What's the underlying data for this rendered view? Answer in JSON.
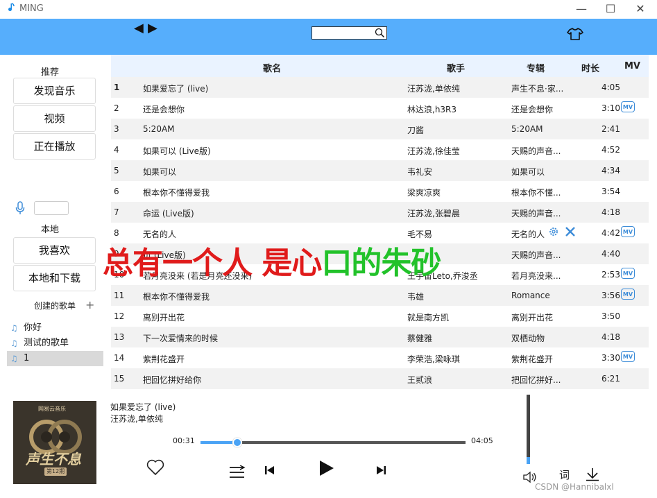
{
  "window": {
    "title": "MING",
    "min_symbol": "—",
    "max_symbol": "☐",
    "close_symbol": "✕"
  },
  "header": {
    "back_symbol": "◀",
    "forward_symbol": "▶",
    "search_placeholder": "",
    "accent_color": "#56aefc"
  },
  "sidebar": {
    "recommend_heading": "推荐",
    "recommend_items": [
      "发现音乐",
      "视频",
      "正在播放"
    ],
    "local_heading": "本地",
    "local_items": [
      "我喜欢",
      "本地和下载"
    ],
    "created_heading": "创建的歌单",
    "add_symbol": "+",
    "playlists": [
      "你好",
      "测试的歌单",
      "1"
    ]
  },
  "table": {
    "columns": {
      "name": "歌名",
      "artist": "歌手",
      "album": "专辑",
      "duration": "时长",
      "mv": "MV"
    },
    "mv_label": "MV",
    "rows": [
      {
        "idx": "1",
        "name": "如果爱忘了 (live)",
        "artist": "汪苏泷,单依纯",
        "album": "声生不息·家...",
        "duration": "4:05",
        "mv": false
      },
      {
        "idx": "2",
        "name": "还是会想你",
        "artist": "林达浪,h3R3",
        "album": "还是会想你",
        "duration": "3:10",
        "mv": true
      },
      {
        "idx": "3",
        "name": "5:20AM",
        "artist": "刀酱",
        "album": "5:20AM",
        "duration": "2:41",
        "mv": false
      },
      {
        "idx": "4",
        "name": "如果可以 (Live版)",
        "artist": "汪苏泷,徐佳莹",
        "album": "天赐的声音...",
        "duration": "4:52",
        "mv": false
      },
      {
        "idx": "5",
        "name": "如果可以",
        "artist": "韦礼安",
        "album": "如果可以",
        "duration": "4:34",
        "mv": false
      },
      {
        "idx": "6",
        "name": "根本你不懂得爱我",
        "artist": "梁爽凉爽",
        "album": "根本你不懂...",
        "duration": "3:54",
        "mv": false
      },
      {
        "idx": "7",
        "name": "命运 (Live版)",
        "artist": "汪苏泷,张碧晨",
        "album": "天赐的声音...",
        "duration": "4:18",
        "mv": false
      },
      {
        "idx": "8",
        "name": "无名的人",
        "artist": "毛不易",
        "album": "无名的人",
        "duration": "4:42",
        "mv": true
      },
      {
        "idx": "9",
        "name": "页 (Live版)",
        "artist": "",
        "album": "天赐的声音...",
        "duration": "4:40",
        "mv": false
      },
      {
        "idx": "10",
        "name": "若月亮没来 (若是月亮还没来)",
        "artist": "王宇宙Leto,乔浚丞",
        "album": "若月亮没来...",
        "duration": "2:53",
        "mv": true
      },
      {
        "idx": "11",
        "name": "根本你不懂得爱我",
        "artist": "韦雄",
        "album": "Romance",
        "duration": "3:56",
        "mv": true
      },
      {
        "idx": "12",
        "name": "离别开出花",
        "artist": "就是南方凯",
        "album": "离别开出花",
        "duration": "3:50",
        "mv": false
      },
      {
        "idx": "13",
        "name": "下一次爱情来的时候",
        "artist": "蔡健雅",
        "album": "双栖动物",
        "duration": "4:18",
        "mv": false
      },
      {
        "idx": "14",
        "name": "紫荆花盛开",
        "artist": "李荣浩,梁咏琪",
        "album": "紫荆花盛开",
        "duration": "3:30",
        "mv": true
      },
      {
        "idx": "15",
        "name": "把回忆拼好给你",
        "artist": "王贰浪",
        "album": "把回忆拼好...",
        "duration": "6:21",
        "mv": false
      }
    ]
  },
  "lyric_overlay": {
    "red_text": "总有一个人 是心",
    "green_text": "口的朱砂"
  },
  "player": {
    "song_title": "如果爱忘了 (live)",
    "song_artist": "汪苏泷,单依纯",
    "current_time": "00:31",
    "total_time": "04:05",
    "progress_fraction": 0.14,
    "volume_fraction": 0.1,
    "cover": {
      "badge": "网易云音乐",
      "title": "声生不息",
      "episode": "第12期"
    },
    "lyric_label": "词"
  },
  "watermark": "CSDN @Hannibalxl"
}
